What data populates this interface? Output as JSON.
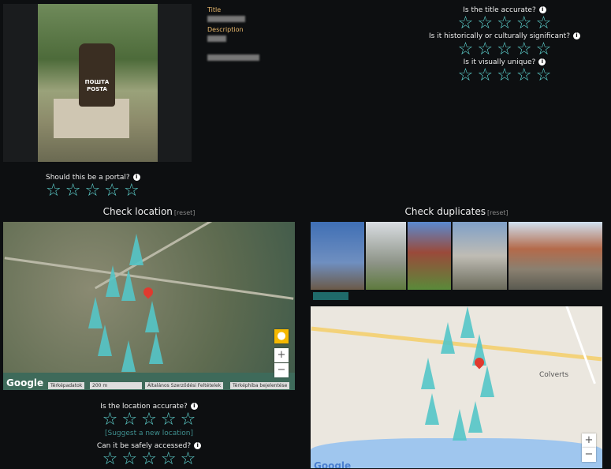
{
  "photo": {
    "caption": "ПОШТА POSTA"
  },
  "meta": {
    "title_label": "Title",
    "description_label": "Description"
  },
  "questions": {
    "title_accurate": "Is the title accurate?",
    "significant": "Is it historically or culturally significant?",
    "unique": "Is it visually unique?",
    "portal": "Should this be a portal?",
    "location_accurate": "Is the location accurate?",
    "safe_access": "Can it be safely accessed?"
  },
  "star_glyph": "☆",
  "info_glyph": "i",
  "location": {
    "title": "Check location",
    "reset": "[reset]",
    "suggest": "[Suggest a new location]"
  },
  "duplicates": {
    "title": "Check duplicates",
    "reset": "[reset]"
  },
  "map_left": {
    "logo": "Google",
    "attribution": [
      "Térképadatok",
      "200 m",
      "Általános Szerződési Feltételek",
      "Térképhiba bejelentése"
    ],
    "zoom_in": "+",
    "zoom_out": "−"
  },
  "map_right": {
    "label": "Colverts",
    "logo": "Google",
    "zoom_in": "+",
    "zoom_out": "−"
  },
  "colors": {
    "accent": "#5fd3d0",
    "label": "#e9b96e"
  }
}
